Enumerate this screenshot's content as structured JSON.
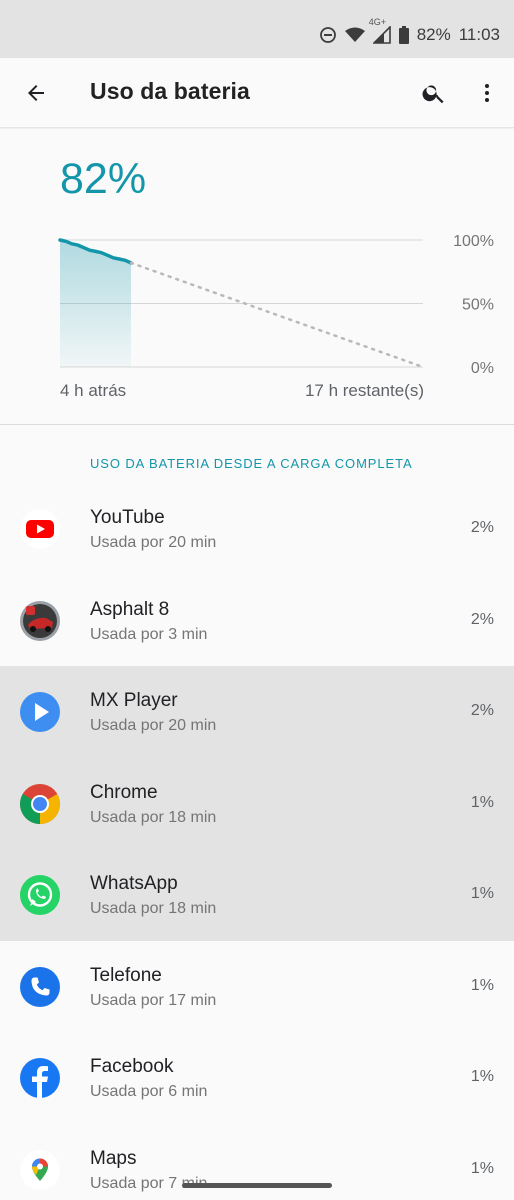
{
  "status_bar": {
    "battery_text": "82%",
    "time": "11:03",
    "network_label": "4G+",
    "icons": [
      "do-not-disturb-icon",
      "wifi-icon",
      "signal-icon",
      "battery-icon"
    ]
  },
  "app_bar": {
    "title": "Uso da bateria",
    "icons": [
      "back-arrow-icon",
      "search-icon",
      "more-vert-icon"
    ]
  },
  "battery": {
    "percent_label": "82%",
    "time_ago": "4 h atrás",
    "time_remaining": "17 h restante(s)",
    "axis_labels": [
      "100%",
      "50%",
      "0%"
    ],
    "accent_color": "#1396a9"
  },
  "chart_data": {
    "type": "area",
    "ylim": [
      0,
      100
    ],
    "y_ticks": [
      "100%",
      "50%",
      "0%"
    ],
    "x_labels": [
      "4 h atrás",
      "17 h restante(s)"
    ],
    "series": [
      {
        "values": [
          100,
          99,
          97,
          96,
          94,
          92,
          91,
          90,
          88,
          86,
          85,
          84,
          82
        ],
        "style": "solid"
      },
      {
        "values": [
          82,
          0
        ],
        "style": "dotted"
      }
    ],
    "grid": true
  },
  "section": {
    "header": "USO DA BATERIA DESDE A CARGA COMPLETA"
  },
  "apps": [
    {
      "name": "YouTube",
      "usage": "Usada por 20 min",
      "percent": "2%",
      "icon": "youtube-icon"
    },
    {
      "name": "Asphalt 8",
      "usage": "Usada por 3 min",
      "percent": "2%",
      "icon": "asphalt-icon"
    },
    {
      "name": "MX Player",
      "usage": "Usada por 20 min",
      "percent": "2%",
      "icon": "mx-player-icon"
    },
    {
      "name": "Chrome",
      "usage": "Usada por 18 min",
      "percent": "1%",
      "icon": "chrome-icon"
    },
    {
      "name": "WhatsApp",
      "usage": "Usada por 18 min",
      "percent": "1%",
      "icon": "whatsapp-icon"
    },
    {
      "name": "Telefone",
      "usage": "Usada por 17 min",
      "percent": "1%",
      "icon": "phone-icon"
    },
    {
      "name": "Facebook",
      "usage": "Usada por 6 min",
      "percent": "1%",
      "icon": "facebook-icon"
    },
    {
      "name": "Maps",
      "usage": "Usada por 7 min",
      "percent": "1%",
      "icon": "maps-icon"
    }
  ]
}
